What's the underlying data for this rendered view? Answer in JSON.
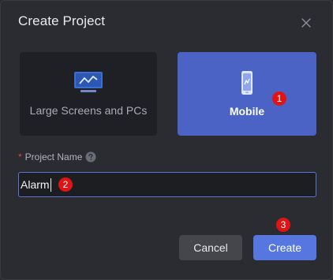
{
  "dialog": {
    "title": "Create Project",
    "close_icon": "close-icon"
  },
  "options": [
    {
      "label": "Large Screens and PCs",
      "icon": "monitor-chart-icon",
      "selected": false
    },
    {
      "label": "Mobile",
      "icon": "phone-chart-icon",
      "selected": true
    }
  ],
  "project_name": {
    "required_mark": "*",
    "label": "Project Name",
    "help_icon": "question-circle-icon",
    "value": "Alarm"
  },
  "buttons": {
    "cancel": "Cancel",
    "create": "Create"
  },
  "step_markers": [
    "1",
    "2",
    "3"
  ],
  "colors": {
    "accent": "#4a63c4",
    "primary_button": "#5677e0",
    "marker": "#e01414"
  }
}
